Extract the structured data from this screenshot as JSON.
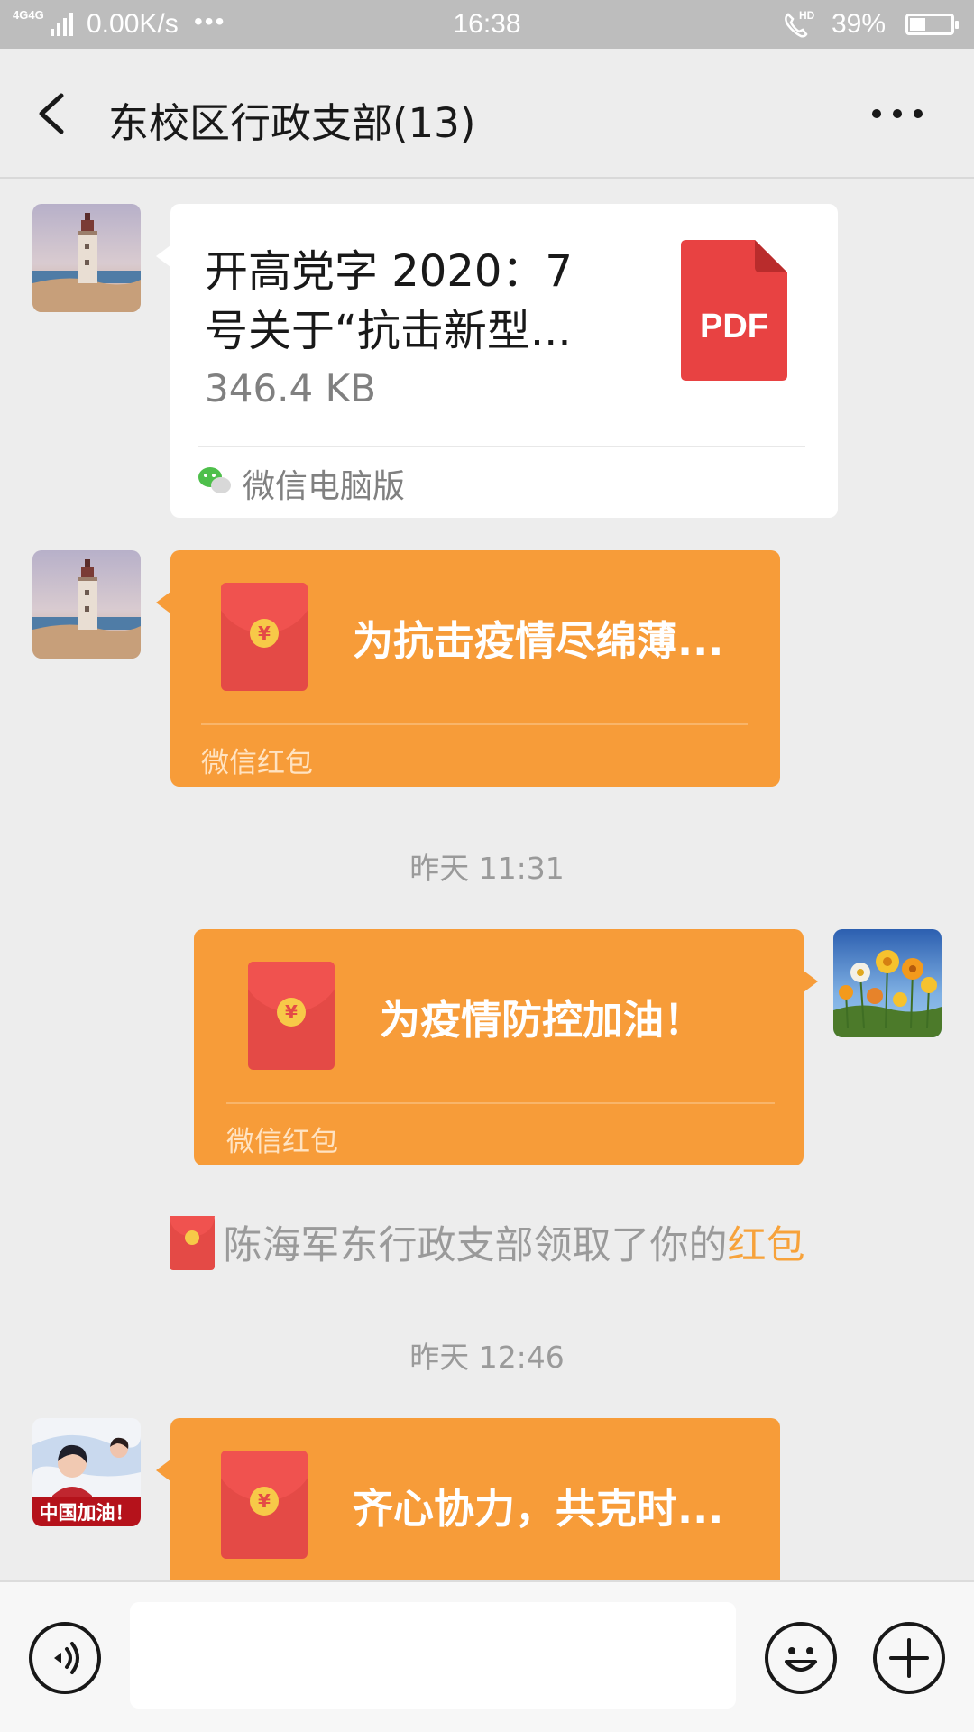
{
  "status_bar": {
    "network": "4G",
    "network2": "4G",
    "speed": "0.00K/s",
    "dots": "•••",
    "time": "16:38",
    "hd_label": "HD",
    "battery_percent": "39%",
    "battery_level": 0.39
  },
  "header": {
    "title": "东校区行政支部(13)",
    "member_count": 13
  },
  "messages": {
    "file": {
      "name": "开高党字 2020：7 号关于“抗击新型...",
      "size": "346.4 KB",
      "type_label": "PDF",
      "source": "微信电脑版"
    },
    "redpacket1": {
      "title": "为抗击疫情尽绵薄...",
      "label": "微信红包"
    },
    "time1": "昨天 11:31",
    "redpacket2": {
      "title": "为疫情防控加油！",
      "label": "微信红包"
    },
    "system": {
      "text": "陈海军东行政支部领取了你的",
      "link": "红包"
    },
    "time2": "昨天 12:46",
    "redpacket3": {
      "title": "齐心协力，共克时...",
      "avatar_caption": "中国加油！"
    }
  },
  "input_bar": {
    "placeholder": ""
  },
  "icons": {
    "back": "chevron-left-icon",
    "more": "more-dots-icon",
    "voice": "voice-icon",
    "emoji": "emoji-icon",
    "plus": "plus-icon",
    "red_packet": "red-packet-icon",
    "pdf": "pdf-icon"
  },
  "colors": {
    "background": "#ededed",
    "red_packet_bubble": "#f79c39",
    "envelope": "#e44a46",
    "coin": "#f7c948",
    "pdf": "#e84242",
    "link": "#f7a23a"
  }
}
